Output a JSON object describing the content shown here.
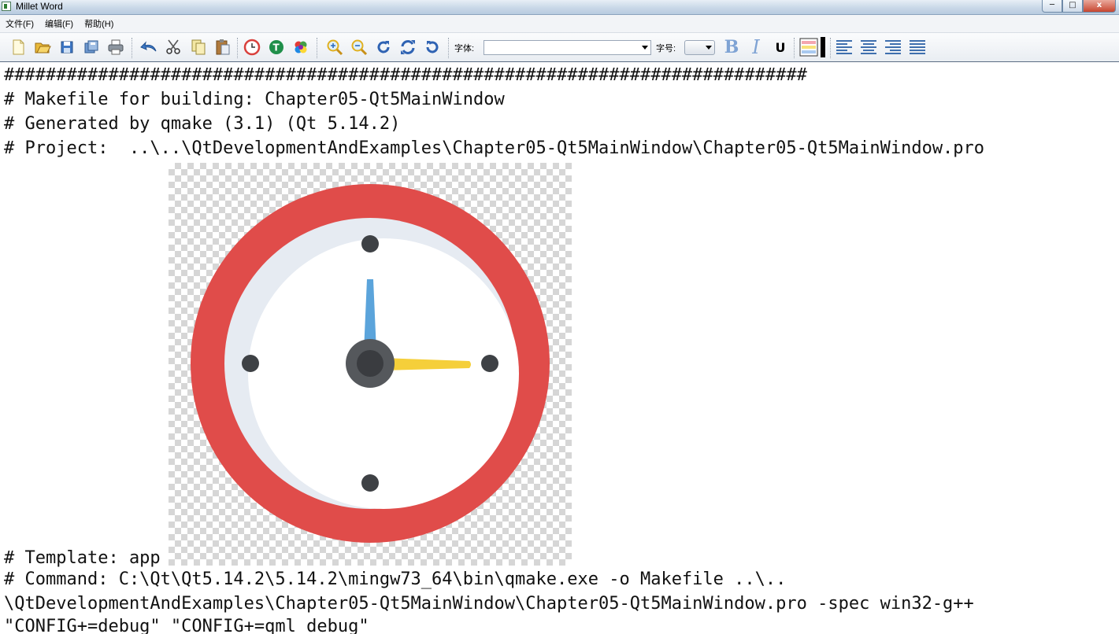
{
  "window": {
    "title": "Millet Word",
    "minimize": "─",
    "maximize": "□",
    "close": "x"
  },
  "menu": {
    "items": [
      {
        "label": "文件(F)"
      },
      {
        "label": "编辑(F)"
      },
      {
        "label": "帮助(H)"
      }
    ]
  },
  "toolbar": {
    "font_label": "字体:",
    "font_value": "",
    "size_label": "字号:",
    "size_value": "",
    "bold": "B",
    "italic": "I",
    "underline": "U"
  },
  "document": {
    "lines": [
      "#############################################################################",
      "# Makefile for building: Chapter05-Qt5MainWindow",
      "# Generated by qmake (3.1) (Qt 5.14.2)",
      "# Project:  ..\\..\\QtDevelopmentAndExamples\\Chapter05-Qt5MainWindow\\Chapter05-Qt5MainWindow.pro",
      "# Template: app",
      "# Command: C:\\Qt\\Qt5.14.2\\5.14.2\\mingw73_64\\bin\\qmake.exe -o Makefile ..\\..",
      "\\QtDevelopmentAndExamples\\Chapter05-Qt5MainWindow\\Chapter05-Qt5MainWindow.pro -spec win32-g++",
      "\"CONFIG+=debug\" \"CONFIG+=qml_debug\""
    ],
    "embedded_image": "clock-icon"
  },
  "colors": {
    "clock_ring": "#e04c4a",
    "clock_face": "#ffffff",
    "clock_shadow": "#e6ebf2",
    "minute_hand": "#5ba4db",
    "hour_hand": "#f5cf3a",
    "marks": "#3e4145"
  }
}
